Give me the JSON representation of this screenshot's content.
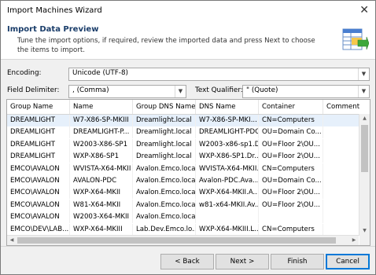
{
  "window": {
    "title": "Import Machines Wizard"
  },
  "header": {
    "title": "Import Data Preview",
    "subtitle": "Tune the import options, if required, review the imported data and press Next to choose the items to import."
  },
  "options": {
    "encoding_label": "Encoding:",
    "encoding_value": "Unicode (UTF-8)",
    "delimiter_label": "Field Delimiter:",
    "delimiter_value": ", (Comma)",
    "qualifier_label": "Text Qualifier:",
    "qualifier_value": "\" (Quote)"
  },
  "table": {
    "columns": [
      "Group Name",
      "Name",
      "Group DNS Name",
      "DNS Name",
      "Container",
      "Comment"
    ],
    "rows": [
      [
        "DREAMLIGHT",
        "W7-X86-SP-MKIII",
        "Dreamlight.local",
        "W7-X86-SP-MKI...",
        "CN=Computers",
        ""
      ],
      [
        "DREAMLIGHT",
        "DREAMLIGHT-P...",
        "Dreamlight.local",
        "DREAMLIGHT-PDC...",
        "OU=Domain Co...",
        ""
      ],
      [
        "DREAMLIGHT",
        "W2003-X86-SP1",
        "Dreamlight.local",
        "W2003-x86-sp1.D...",
        "OU=Floor 2\\OU...",
        ""
      ],
      [
        "DREAMLIGHT",
        "WXP-X86-SP1",
        "Dreamlight.local",
        "WXP-X86-SP1.Dr...",
        "OU=Floor 2\\OU...",
        ""
      ],
      [
        "EMCO\\AVALON",
        "WVISTA-X64-MKII",
        "Avalon.Emco.local",
        "WVISTA-X64-MKII...",
        "CN=Computers",
        ""
      ],
      [
        "EMCO\\AVALON",
        "AVALON-PDC",
        "Avalon.Emco.local",
        "Avalon-PDC.Ava...",
        "OU=Domain Co...",
        ""
      ],
      [
        "EMCO\\AVALON",
        "WXP-X64-MKII",
        "Avalon.Emco.local",
        "WXP-X64-MKII.A...",
        "OU=Floor 2\\OU...",
        ""
      ],
      [
        "EMCO\\AVALON",
        "W81-X64-MKII",
        "Avalon.Emco.local",
        "w81-x64-MKII.Av...",
        "OU=Floor 2\\OU...",
        ""
      ],
      [
        "EMCO\\AVALON",
        "W2003-X64-MKII",
        "Avalon.Emco.local",
        "",
        "",
        ""
      ],
      [
        "EMCO\\DEV\\LAB...",
        "WXP-X64-MKIII",
        "Lab.Dev.Emco.lo...",
        "WXP-X64-MKIII.L...",
        "CN=Computers",
        ""
      ]
    ]
  },
  "buttons": {
    "back": "< Back",
    "next": "Next >",
    "finish": "Finish",
    "cancel": "Cancel"
  }
}
